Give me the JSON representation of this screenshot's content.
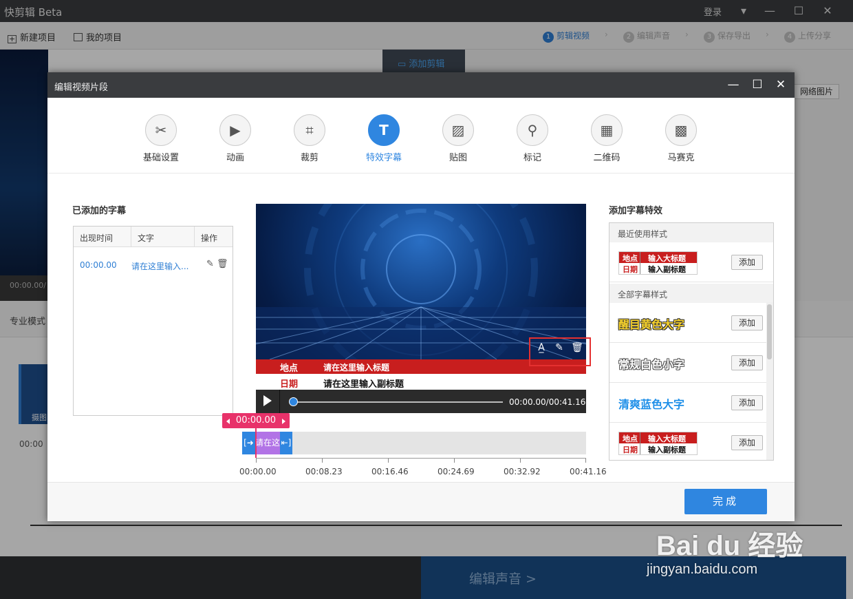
{
  "app": {
    "title": "快剪辑 Beta",
    "login": "登录"
  },
  "toolbar": {
    "new_project": "新建项目",
    "my_projects": "我的项目",
    "steps": [
      {
        "num": "1",
        "label": "剪辑视频"
      },
      {
        "num": "2",
        "label": "编辑声音"
      },
      {
        "num": "3",
        "label": "保存导出"
      },
      {
        "num": "4",
        "label": "上传分享"
      }
    ]
  },
  "background": {
    "add_clip_tab": "添加剪辑",
    "network_image": "网络图片",
    "time": "00:00.00/",
    "pro_mode": "专业模式",
    "thumb_label": "摄图",
    "timeline_zero": "00:00",
    "edit_audio": "编辑声音 >"
  },
  "dialog": {
    "title": "编辑视频片段",
    "tools": [
      {
        "label": "基础设置",
        "icon": "scissors-icon"
      },
      {
        "label": "动画",
        "icon": "animation-icon"
      },
      {
        "label": "裁剪",
        "icon": "crop-icon"
      },
      {
        "label": "特效字幕",
        "icon": "text-icon"
      },
      {
        "label": "贴图",
        "icon": "image-icon"
      },
      {
        "label": "标记",
        "icon": "pin-icon"
      },
      {
        "label": "二维码",
        "icon": "qrcode-icon"
      },
      {
        "label": "马赛克",
        "icon": "mosaic-icon"
      }
    ],
    "active_tool": "特效字幕",
    "left_panel": {
      "title": "已添加的字幕",
      "headers": [
        "出现时间",
        "文字",
        "操作"
      ],
      "rows": [
        {
          "time": "00:00.00",
          "text": "请在这里输入..."
        }
      ]
    },
    "preview": {
      "subtitle_label_1": "地点",
      "subtitle_title": "请在这里输入标题",
      "subtitle_label_2": "日期",
      "subtitle_subtitle": "请在这里输入副标题",
      "time_readout": "00:00.00/00:41.16",
      "progress": 0.0
    },
    "timeline": {
      "current": "00:00.00",
      "clip_text": "请在这",
      "ticks": [
        "00:00.00",
        "00:08.23",
        "00:16.46",
        "00:24.69",
        "00:32.92",
        "00:41.16"
      ]
    },
    "right_panel": {
      "title": "添加字幕特效",
      "recent_section": "最近使用样式",
      "all_section": "全部字幕样式",
      "add_label": "添加",
      "mini_style": {
        "a": "地点",
        "b": "输入大标题",
        "c": "日期",
        "d": "输入副标题"
      },
      "styles": [
        "醒目黄色大字",
        "常规白色小字",
        "清爽蓝色大字"
      ]
    },
    "done": "完成"
  },
  "watermark": {
    "logo": "Bai du 经验",
    "url": "jingyan.baidu.com"
  }
}
